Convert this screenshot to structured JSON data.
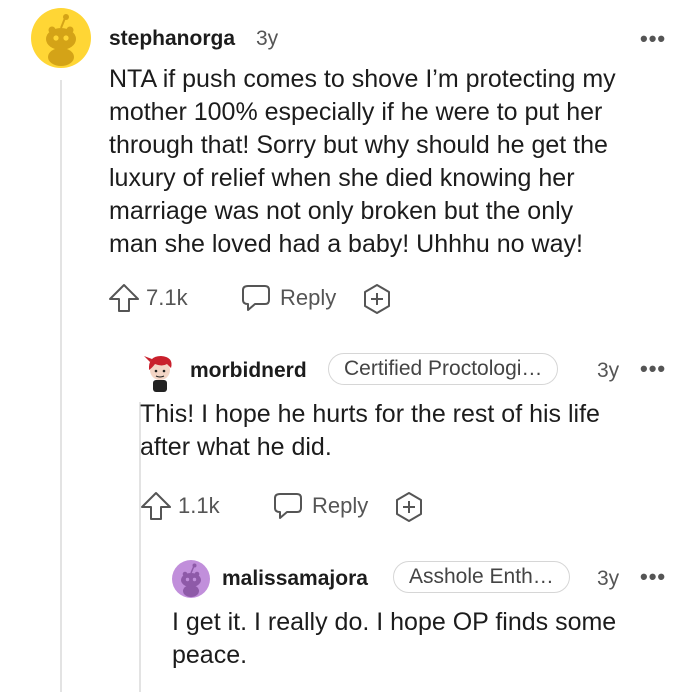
{
  "comments": [
    {
      "username": "stephanorga",
      "age": "3y",
      "body_lines": [
        "NTA if push comes to shove I’m protecting my",
        "mother 100% especially if he were to put her",
        "through that! Sorry but why should he get the",
        "luxury of relief when she died knowing her",
        "marriage was not only broken but the only",
        "man she loved had a baby! Uhhhu no way!"
      ],
      "votes": "7.1k",
      "reply_label": "Reply",
      "avatar_color": "#FFD635"
    },
    {
      "username": "morbidnerd",
      "flair": "Certified Proctologi…",
      "age": "3y",
      "body_lines": [
        "This! I hope he hurts for the rest of his life",
        "after what he did."
      ],
      "votes": "1.1k",
      "reply_label": "Reply"
    },
    {
      "username": "malissamajora",
      "flair": "Asshole Enth…",
      "age": "3y",
      "body_lines": [
        "I get it. I really do. I hope OP finds some",
        "peace."
      ],
      "avatar_color": "#C18FDB"
    }
  ],
  "more_glyph": "•••"
}
